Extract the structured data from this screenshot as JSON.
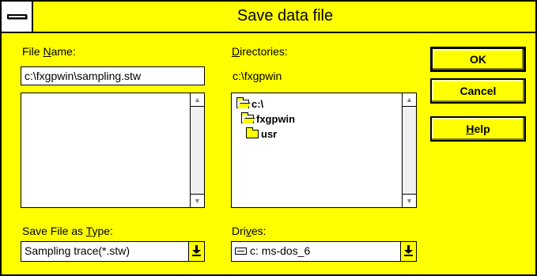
{
  "window": {
    "title": "Save data file"
  },
  "file_name": {
    "label_pre": "File ",
    "label_ul": "N",
    "label_post": "ame:",
    "value": "c:\\fxgpwin\\sampling.stw"
  },
  "directories": {
    "label_ul": "D",
    "label_post": "irectories:",
    "current": "c:\\fxgpwin",
    "items": [
      {
        "label": "c:\\",
        "icon": "open-folder-icon"
      },
      {
        "label": "fxgpwin",
        "icon": "open-folder-icon"
      },
      {
        "label": "usr",
        "icon": "folder-icon"
      }
    ]
  },
  "file_type": {
    "label_pre": "Save File as ",
    "label_ul": "T",
    "label_post": "ype:",
    "value": "Sampling trace(*.stw)"
  },
  "drives": {
    "label_pre": "Dri",
    "label_ul": "v",
    "label_post": "es:",
    "value": "c: ms-dos_6",
    "icon": "hard-drive-icon"
  },
  "buttons": {
    "ok": "OK",
    "cancel": "Cancel",
    "help_ul": "H",
    "help_post": "elp"
  },
  "colors": {
    "face": "#ffff00",
    "border": "#000000",
    "field": "#ffffff"
  }
}
